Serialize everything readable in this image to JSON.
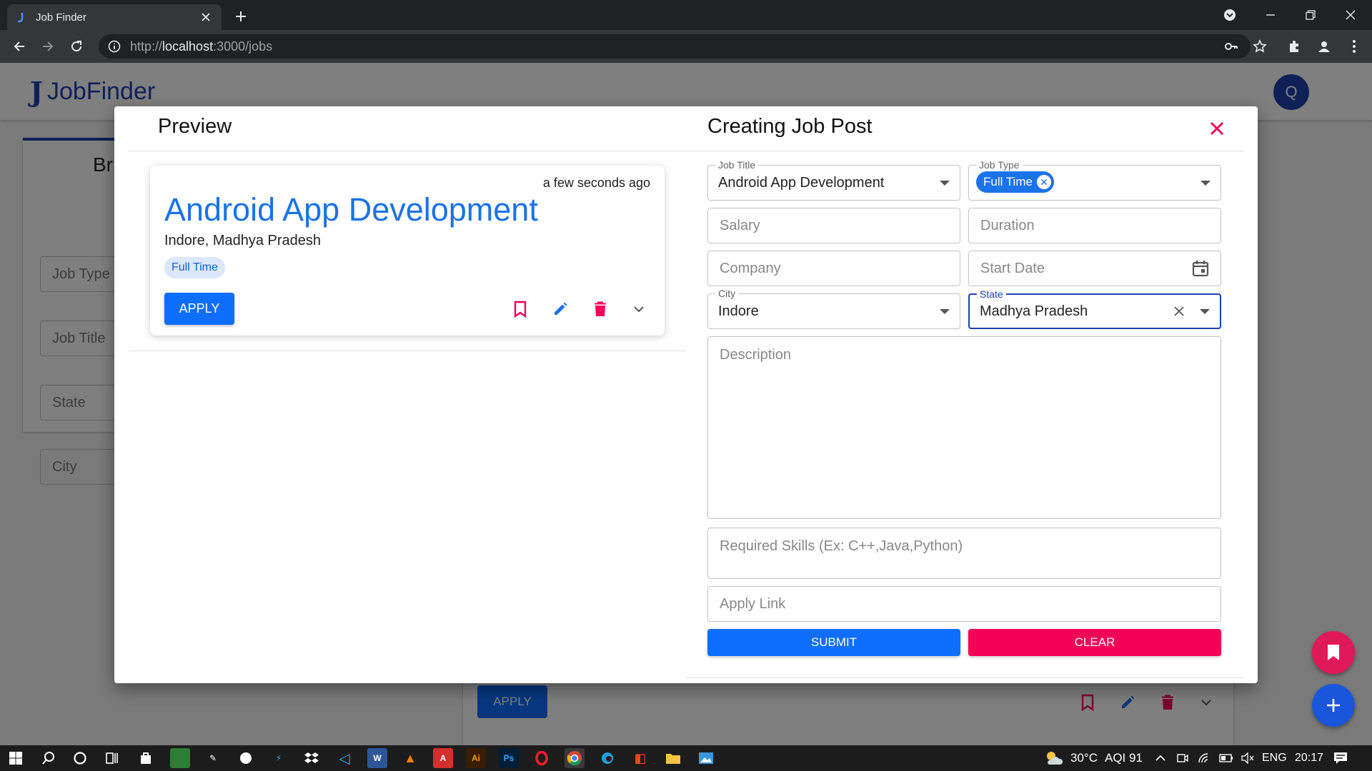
{
  "browser": {
    "tab_title": "Job Finder",
    "url_scheme": "http://",
    "url_host": "localhost",
    "url_path": ":3000/jobs"
  },
  "app": {
    "brand_name": "JobFinder",
    "avatar_letter": "Q",
    "filter_heading": "Br",
    "filters": [
      "Job Type",
      "Job Title",
      "State",
      "City"
    ],
    "background_apply": "APPLY"
  },
  "modal": {
    "preview_title": "Preview",
    "create_title": "Creating Job Post",
    "preview_card": {
      "time": "a few seconds ago",
      "title": "Android App Development",
      "location": "Indore, Madhya Pradesh",
      "chip": "Full Time",
      "apply_label": "APPLY"
    },
    "form": {
      "job_title_label": "Job Title",
      "job_title_value": "Android App Development",
      "job_type_label": "Job Type",
      "job_type_chip": "Full Time",
      "salary_placeholder": "Salary",
      "duration_placeholder": "Duration",
      "company_placeholder": "Company",
      "start_date_placeholder": "Start Date",
      "city_label": "City",
      "city_value": "Indore",
      "state_label": "State",
      "state_value": "Madhya Pradesh",
      "description_placeholder": "Description",
      "skills_placeholder": "Required Skills (Ex: C++,Java,Python)",
      "apply_link_placeholder": "Apply Link",
      "submit_label": "SUBMIT",
      "clear_label": "CLEAR"
    }
  },
  "taskbar": {
    "weather": "30°C",
    "aqi": "AQI 91",
    "language": "ENG",
    "time": "20:17"
  },
  "colors": {
    "primary": "#0d6efd",
    "brand": "#1e40af",
    "danger": "#f50057",
    "link_title": "#1a73e8"
  }
}
